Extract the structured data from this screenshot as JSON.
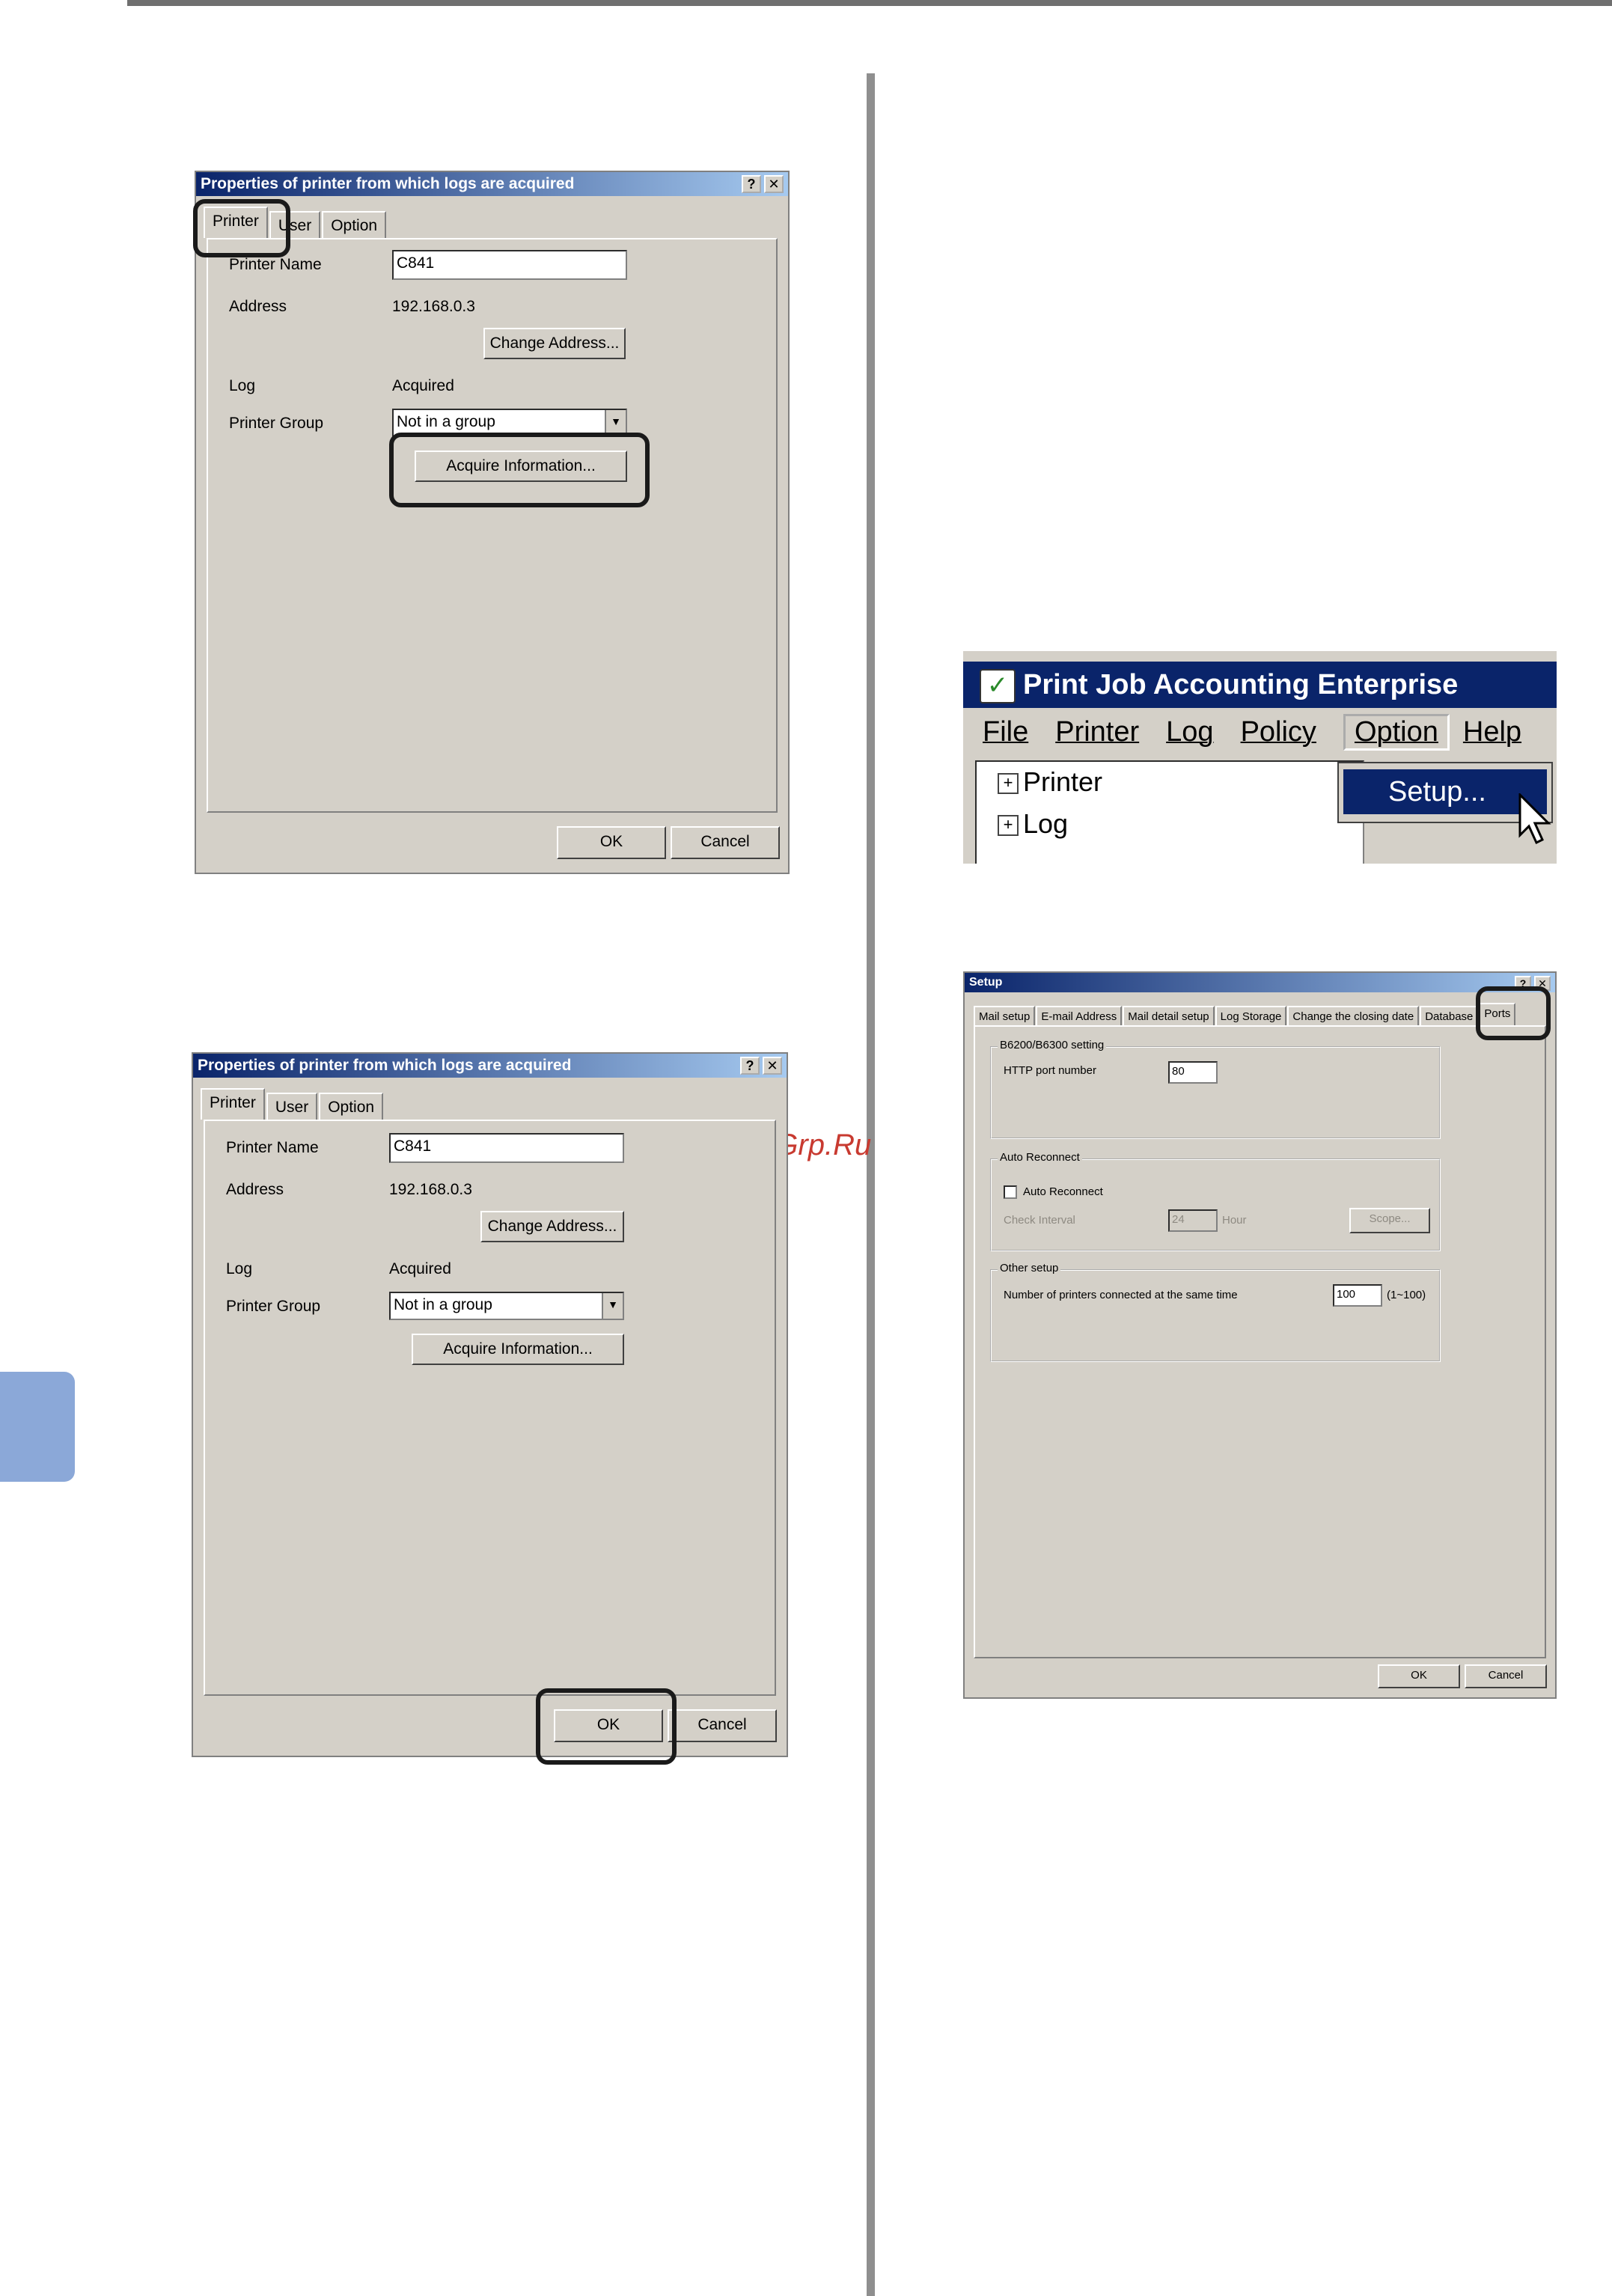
{
  "watermark": "McGrp.Ru",
  "dialog1": {
    "title": "Properties of printer from which logs are acquired",
    "help_btn": "?",
    "close_btn": "✕",
    "tabs": [
      "Printer",
      "User",
      "Option"
    ],
    "labels": {
      "printer_name": "Printer Name",
      "address": "Address",
      "log": "Log",
      "printer_group": "Printer Group"
    },
    "values": {
      "printer_name": "C841",
      "address": "192.168.0.3",
      "log": "Acquired",
      "printer_group": "Not in a group"
    },
    "buttons": {
      "change_address": "Change Address...",
      "acquire_information": "Acquire Information...",
      "ok": "OK",
      "cancel": "Cancel"
    }
  },
  "dialog2": {
    "title": "Properties of printer from which logs are acquired",
    "help_btn": "?",
    "close_btn": "✕",
    "tabs": [
      "Printer",
      "User",
      "Option"
    ],
    "labels": {
      "printer_name": "Printer Name",
      "address": "Address",
      "log": "Log",
      "printer_group": "Printer Group"
    },
    "values": {
      "printer_name": "C841",
      "address": "192.168.0.3",
      "log": "Acquired",
      "printer_group": "Not in a group"
    },
    "buttons": {
      "change_address": "Change Address...",
      "acquire_information": "Acquire Information...",
      "ok": "OK",
      "cancel": "Cancel"
    }
  },
  "menu": {
    "app_title": "Print Job Accounting Enterprise",
    "items": [
      "File",
      "Printer",
      "Log",
      "Policy",
      "Option",
      "Help"
    ],
    "tree": [
      "Printer",
      "Log"
    ],
    "dropdown_item": "Setup..."
  },
  "setup": {
    "title": "Setup",
    "help_btn": "?",
    "close_btn": "✕",
    "tabs": [
      "Mail setup",
      "E-mail Address",
      "Mail detail setup",
      "Log Storage",
      "Change the closing date",
      "Database",
      "Ports"
    ],
    "group1": {
      "title": "B6200/B6300 setting",
      "http_label": "HTTP port number",
      "http_value": "80"
    },
    "group2": {
      "title": "Auto Reconnect",
      "check_label": "Auto Reconnect",
      "interval_label": "Check Interval",
      "interval_value": "24",
      "unit": "Hour",
      "scope_btn": "Scope..."
    },
    "group3": {
      "title": "Other setup",
      "num_label": "Number of printers connected at the same time",
      "num_value": "100",
      "range": "(1~100)"
    },
    "buttons": {
      "ok": "OK",
      "cancel": "Cancel"
    }
  }
}
